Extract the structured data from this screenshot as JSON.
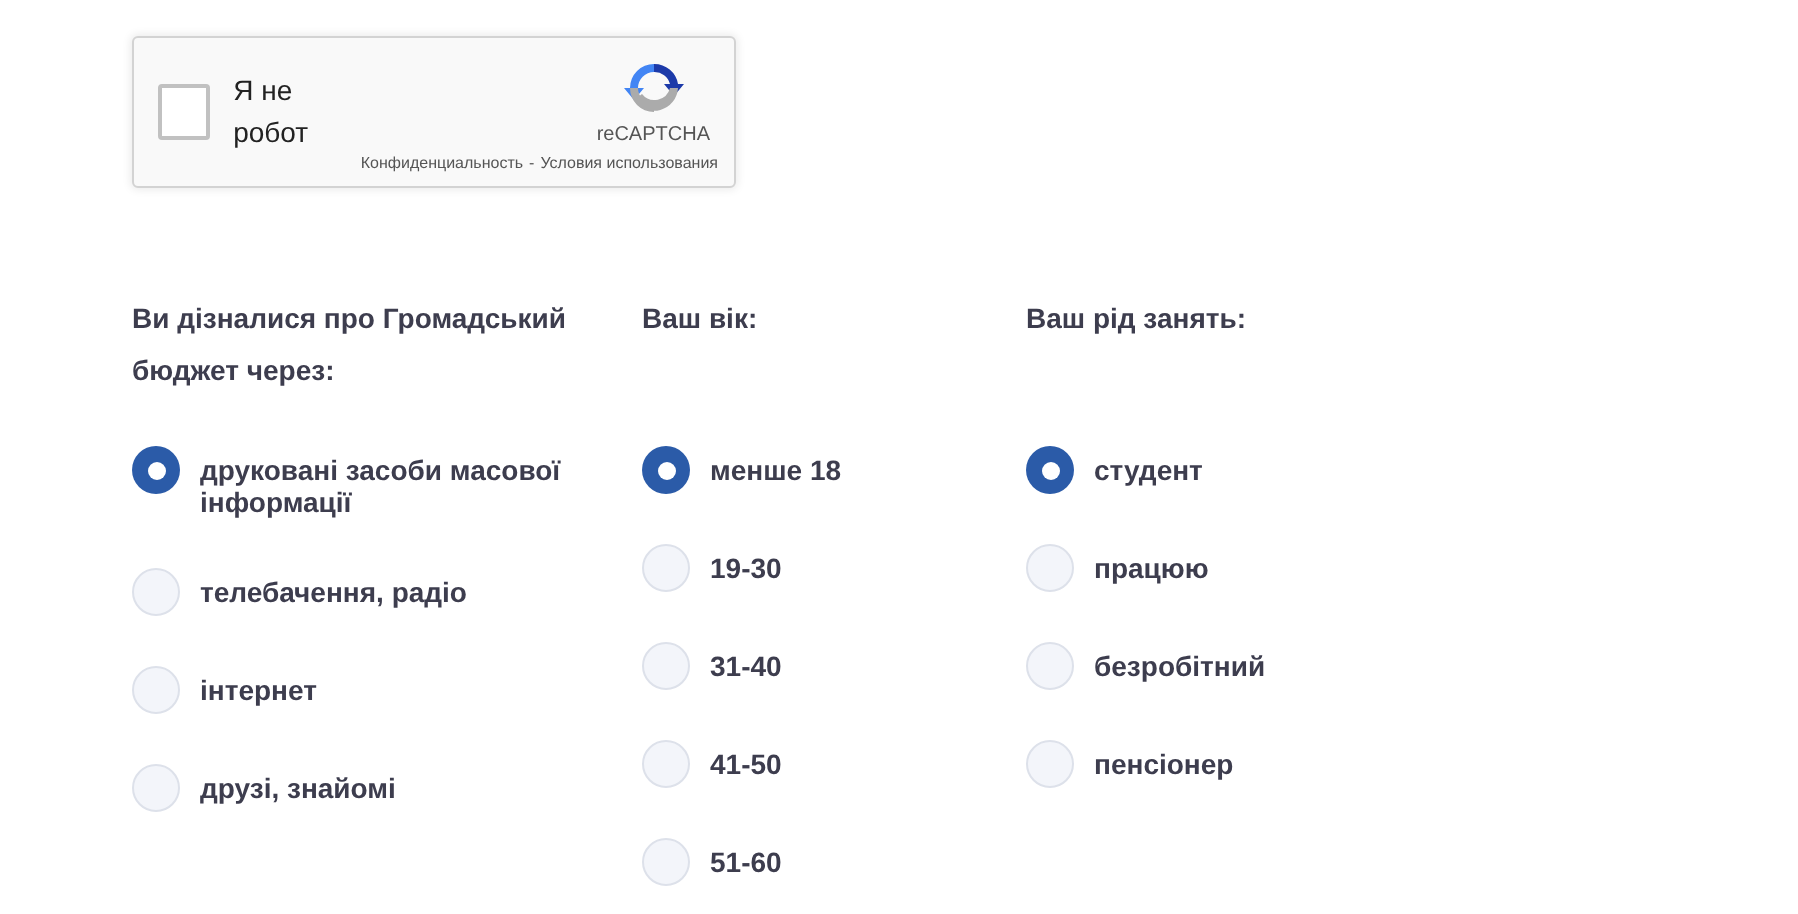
{
  "captcha": {
    "checked": false,
    "label": "Я не робот",
    "brand": "reCAPTCHA",
    "privacy_link": "Конфиденциальность",
    "separator": "-",
    "terms_link": "Условия использования"
  },
  "questions": [
    {
      "title": "Ви дізналися про Громадський бюджет через:",
      "options": [
        {
          "label": "друковані засоби масової інформації",
          "selected": true
        },
        {
          "label": "телебачення, радіо",
          "selected": false
        },
        {
          "label": "інтернет",
          "selected": false
        },
        {
          "label": "друзі, знайомі",
          "selected": false
        }
      ]
    },
    {
      "title": "Ваш вік:",
      "options": [
        {
          "label": "менше 18",
          "selected": true
        },
        {
          "label": "19-30",
          "selected": false
        },
        {
          "label": "31-40",
          "selected": false
        },
        {
          "label": "41-50",
          "selected": false
        },
        {
          "label": "51-60",
          "selected": false
        }
      ]
    },
    {
      "title": "Ваш рід занять:",
      "options": [
        {
          "label": "студент",
          "selected": true
        },
        {
          "label": "працюю",
          "selected": false
        },
        {
          "label": "безробітний",
          "selected": false
        },
        {
          "label": "пенсіонер",
          "selected": false
        }
      ]
    }
  ]
}
